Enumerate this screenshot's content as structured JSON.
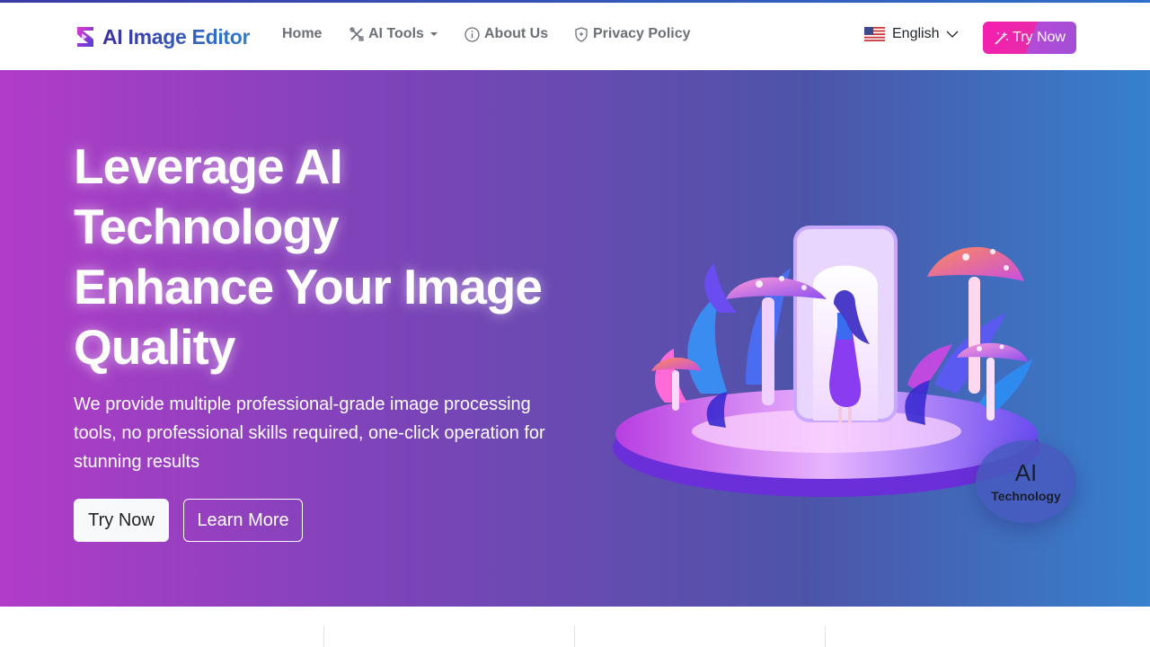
{
  "brand": {
    "name": "AI Image Editor",
    "logo_icon": "s-logo-icon"
  },
  "nav": {
    "items": [
      {
        "label": "Home",
        "icon": ""
      },
      {
        "label": "AI Tools",
        "icon": "tools-icon",
        "dropdown": true
      },
      {
        "label": "About Us",
        "icon": "info-circle-icon"
      },
      {
        "label": "Privacy Policy",
        "icon": "shield-icon"
      }
    ],
    "language": "English",
    "language_icon": "us-flag-icon",
    "try_label": "Try Now",
    "try_icon": "magic-wand-icon"
  },
  "hero": {
    "title_lines": [
      "Leverage AI",
      "Technology",
      "Enhance Your Image",
      "Quality"
    ],
    "subtitle": "We provide multiple professional-grade image processing tools, no professional skills required, one-click operation for stunning results",
    "primary_button": "Try Now",
    "secondary_button": "Learn More",
    "badge": {
      "main": "AI",
      "sub": "Technology"
    }
  },
  "colors": {
    "brand_gradient": [
      "#3a2fa0",
      "#2f7fd0"
    ],
    "hero_gradient": [
      "#b13cc8",
      "#7b44b8",
      "#4d54a8",
      "#3680cd"
    ],
    "accent_pink": "#f41fb1",
    "nav_text": "#6b6f76"
  }
}
